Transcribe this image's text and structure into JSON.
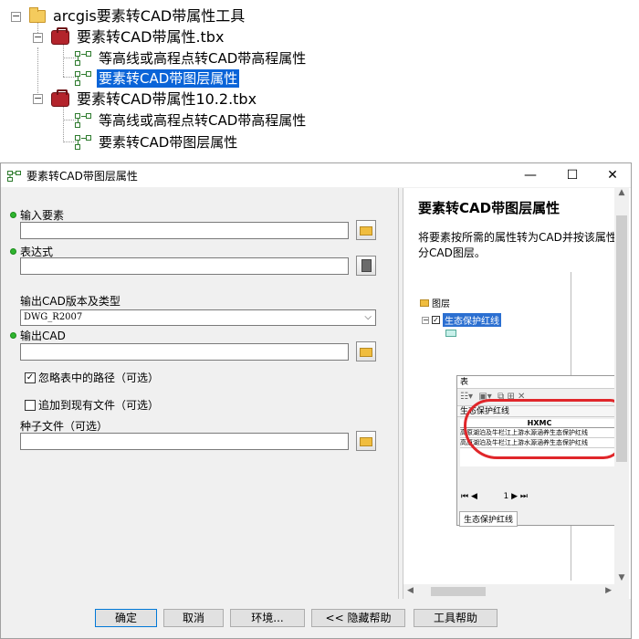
{
  "tree": {
    "root": "arcgis要素转CAD带属性工具",
    "toolboxes": [
      {
        "label": "要素转CAD带属性.tbx",
        "tools": [
          "等高线或高程点转CAD带高程属性",
          "要素转CAD带图层属性"
        ]
      },
      {
        "label": "要素转CAD带属性10.2.tbx",
        "tools": [
          "等高线或高程点转CAD带高程属性",
          "要素转CAD带图层属性"
        ]
      }
    ]
  },
  "dialog": {
    "title": "要素转CAD带图层属性",
    "win_controls": {
      "minimize": "—",
      "maximize": "☐",
      "close": "✕"
    },
    "params": {
      "input_label": "输入要素",
      "input_value": "",
      "expr_label": "表达式",
      "expr_value": "",
      "version_label": "输出CAD版本及类型",
      "version_value": "DWG_R2007",
      "output_label": "输出CAD",
      "output_value": "",
      "ignore_paths_label": "忽略表中的路径（可选）",
      "ignore_paths_checked": true,
      "append_label": "追加到现有文件（可选）",
      "append_checked": false,
      "seed_label": "种子文件（可选）",
      "seed_value": ""
    },
    "help": {
      "title": "要素转CAD带图层属性",
      "body": "将要素按所需的属性转为CAD并按该属性分CAD图层。",
      "toc_layers": "图层",
      "toc_layer_name": "生态保护红线",
      "table_title": "表",
      "table_layer_tab": "生态保护红线",
      "table_col": "HXMC",
      "table_rows": [
        "高原湖泊及牛栏江上游水源涵养生态保护红线",
        "高原湖泊及牛栏江上游水源涵养生态保护红线"
      ],
      "table_record": "1"
    },
    "buttons": {
      "ok": "确定",
      "cancel": "取消",
      "env": "环境...",
      "hide_help": "<< 隐藏帮助",
      "tool_help": "工具帮助"
    }
  }
}
